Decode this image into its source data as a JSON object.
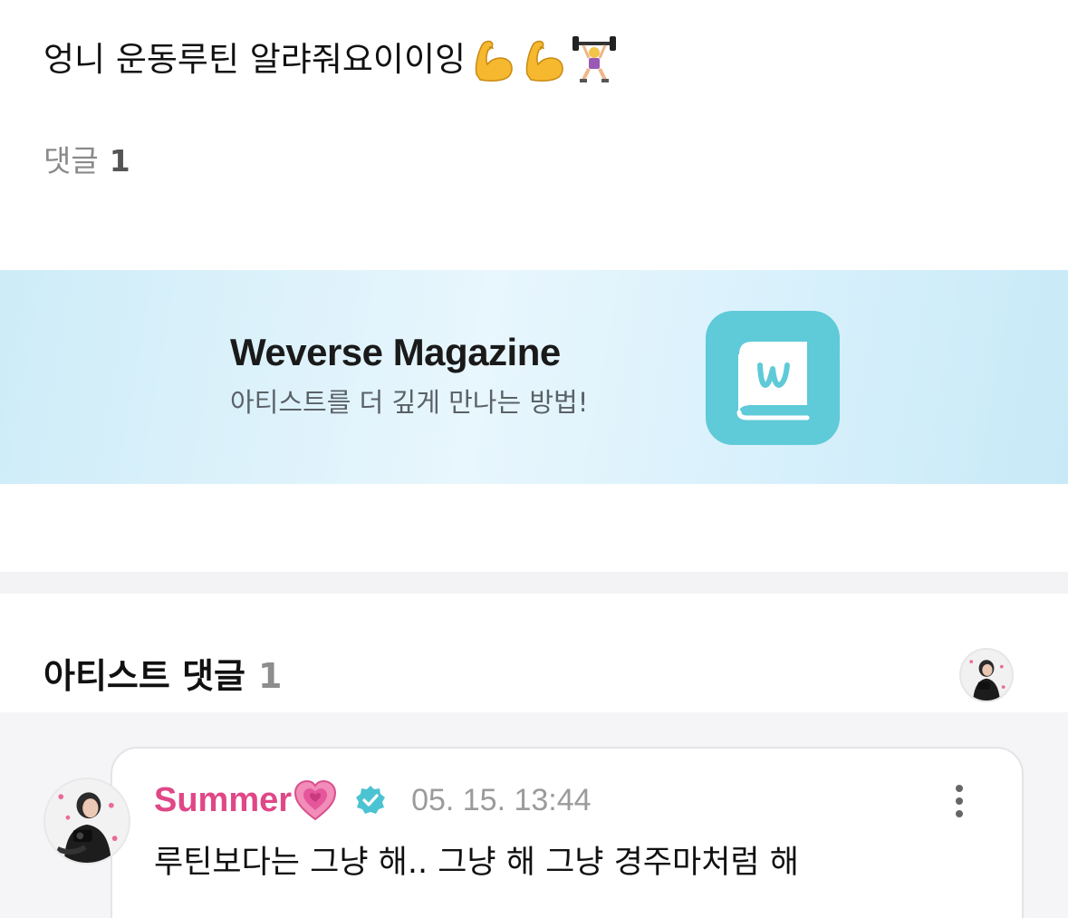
{
  "post": {
    "text": "엉니 운동루틴 알랴줘요이이잉",
    "emojis": [
      "flexed-biceps-icon",
      "flexed-biceps-icon",
      "weightlifter-icon"
    ]
  },
  "comments_summary": {
    "label": "댓글",
    "count": "1"
  },
  "banner": {
    "title": "Weverse Magazine",
    "subtitle": "아티스트를 더 깊게 만나는 방법!",
    "icon": "weverse-magazine-app-icon",
    "accent": "#5fcad8"
  },
  "artist_comments": {
    "title": "아티스트 댓글",
    "count": "1",
    "comment": {
      "author": "Summer",
      "author_color": "#e04787",
      "badge_icons": [
        "growing-heart-icon",
        "verified-badge-icon"
      ],
      "timestamp": "05. 15. 13:44",
      "text": "루틴보다는 그냥 해.. 그냥 해 그냥 경주마처럼 해",
      "menu_icon": "more-vertical-icon"
    }
  }
}
